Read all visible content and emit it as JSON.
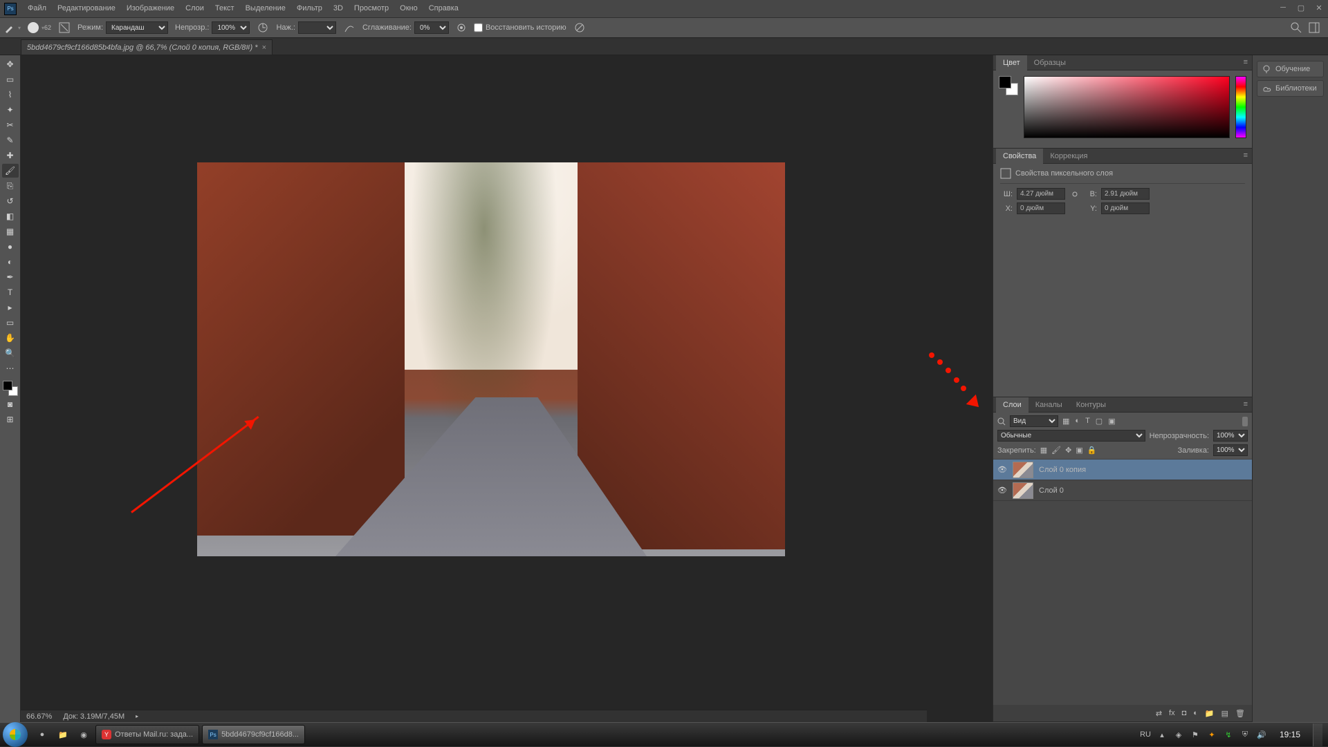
{
  "app": {
    "logo": "Ps"
  },
  "menu": [
    "Файл",
    "Редактирование",
    "Изображение",
    "Слои",
    "Текст",
    "Выделение",
    "Фильтр",
    "3D",
    "Просмотр",
    "Окно",
    "Справка"
  ],
  "options": {
    "brush_size": "62",
    "mode_label": "Режим:",
    "mode_value": "Карандаш",
    "opacity_label": "Непрозр.:",
    "opacity_value": "100%",
    "flow_label": "Наж.:",
    "smoothing_label": "Сглаживание:",
    "smoothing_value": "0%",
    "restore_label": "Восстановить историю"
  },
  "document": {
    "tab_title": "5bdd4679cf9cf166d85b4bfa.jpg @ 66,7% (Слой 0 копия, RGB/8#) *"
  },
  "status": {
    "zoom": "66.67%",
    "doc": "Док: 3.19M/7,45M"
  },
  "panel_tabs": {
    "color": "Цвет",
    "swatches": "Образцы",
    "properties": "Свойства",
    "adjust": "Коррекция",
    "layers": "Слои",
    "channels": "Каналы",
    "paths": "Контуры"
  },
  "collapsed": {
    "learn": "Обучение",
    "libraries": "Библиотеки"
  },
  "properties": {
    "title": "Свойства пиксельного слоя",
    "w_label": "Ш:",
    "w": "4.27 дюйм",
    "h_label": "В:",
    "h": "2.91 дюйм",
    "x_label": "X:",
    "x": "0 дюйм",
    "y_label": "Y:",
    "y": "0 дюйм"
  },
  "layers_panel": {
    "kind_label": "Вид",
    "blend": "Обычные",
    "opacity_label": "Непрозрачность:",
    "opacity": "100%",
    "lock_label": "Закрепить:",
    "fill_label": "Заливка:",
    "fill": "100%",
    "layers": [
      {
        "name": "Слой 0 копия",
        "selected": true
      },
      {
        "name": "Слой 0",
        "selected": false
      }
    ]
  },
  "taskbar": {
    "tasks": [
      {
        "icon": "Y",
        "label": "Ответы Mail.ru: зада..."
      },
      {
        "icon": "Ps",
        "label": "5bdd4679cf9cf166d8..."
      }
    ],
    "lang": "RU",
    "time": "19:15"
  }
}
